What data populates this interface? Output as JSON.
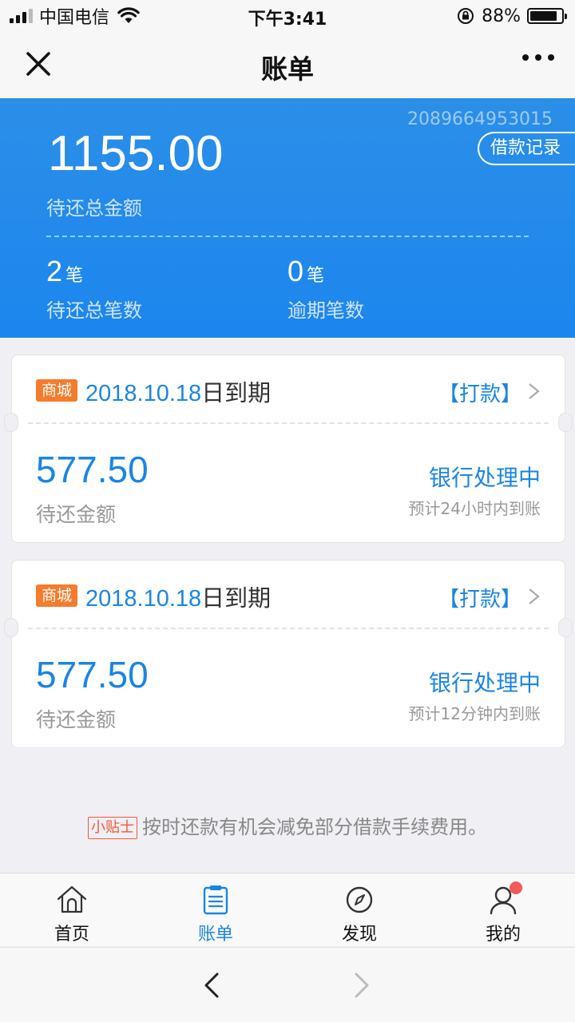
{
  "status_bar": {
    "carrier": "中国电信",
    "time": "下午3:41",
    "battery": "88%",
    "battery_level": 0.88
  },
  "nav": {
    "title": "账单"
  },
  "summary": {
    "account_number": "2089664953015",
    "records_button": "借款记录",
    "total_amount": "1155.00",
    "total_label": "待还总金额",
    "pending_count": "2",
    "pending_unit": "笔",
    "pending_label": "待还总笔数",
    "overdue_count": "0",
    "overdue_unit": "笔",
    "overdue_label": "逾期笔数"
  },
  "bills": [
    {
      "tag": "商城",
      "date": "2018.10.18",
      "date_suffix": "日到期",
      "action": "【打款】",
      "amount": "577.50",
      "amount_label": "待还金额",
      "status": "银行处理中",
      "eta": "预计24小时内到账"
    },
    {
      "tag": "商城",
      "date": "2018.10.18",
      "date_suffix": "日到期",
      "action": "【打款】",
      "amount": "577.50",
      "amount_label": "待还金额",
      "status": "银行处理中",
      "eta": "预计12分钟内到账"
    }
  ],
  "tip": {
    "badge": "小贴士",
    "text": "按时还款有机会减免部分借款手续费用。"
  },
  "tabs": [
    {
      "label": "首页",
      "icon": "home-icon"
    },
    {
      "label": "账单",
      "icon": "bill-icon",
      "active": true
    },
    {
      "label": "发现",
      "icon": "compass-icon"
    },
    {
      "label": "我的",
      "icon": "user-icon",
      "badge_dot": true
    }
  ],
  "colors": {
    "primary": "#1b85e3",
    "header_bg": "#2b8fe8",
    "tag": "#f47c2c",
    "tip_badge": "#f05a3a"
  }
}
